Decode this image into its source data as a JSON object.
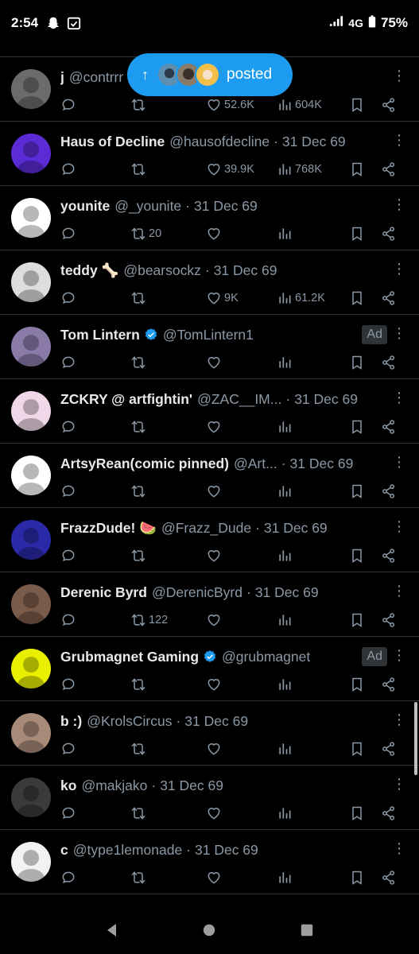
{
  "status_bar": {
    "time": "2:54",
    "network": "4G",
    "battery": "75%",
    "icons": [
      "snapchat-ghost-icon",
      "calendar-check-icon",
      "signal-icon",
      "battery-icon"
    ]
  },
  "posted_pill": {
    "label": "posted",
    "icon": "arrow-up-icon"
  },
  "tweets": [
    {
      "name": "j",
      "handle": "@contrrr",
      "date": "",
      "verified": false,
      "ad": "",
      "reply": "",
      "retweet": "",
      "like": "52.6K",
      "views": "604K",
      "avatar": "#6b6b6b"
    },
    {
      "name": "Haus of Decline",
      "handle": "@hausofdecline",
      "date": "31 Dec 69",
      "verified": false,
      "ad": "",
      "reply": "",
      "retweet": "",
      "like": "39.9K",
      "views": "768K",
      "avatar": "#5b2bd6"
    },
    {
      "name": "younite",
      "handle": "@_younite",
      "date": "31 Dec 69",
      "verified": false,
      "ad": "",
      "reply": "",
      "retweet": "20",
      "like": "",
      "views": "",
      "avatar": "#ffffff"
    },
    {
      "name": "teddy 🦴",
      "handle": "@bearsockz",
      "date": "31 Dec 69",
      "verified": false,
      "ad": "",
      "reply": "",
      "retweet": "",
      "like": "9K",
      "views": "61.2K",
      "avatar": "#dddddd"
    },
    {
      "name": "Tom Lintern",
      "handle": "@TomLintern1",
      "date": "",
      "verified": true,
      "ad": "Ad",
      "reply": "",
      "retweet": "",
      "like": "",
      "views": "",
      "avatar": "#8a7aa8"
    },
    {
      "name": "ZCKRY @ artfightin'",
      "handle": "@ZAC__IM...",
      "date": "31 Dec 69",
      "verified": false,
      "ad": "",
      "reply": "",
      "retweet": "",
      "like": "",
      "views": "",
      "avatar": "#f0d8e8"
    },
    {
      "name": "ArtsyRean(comic pinned)",
      "handle": "@Art...",
      "date": "31 Dec 69",
      "verified": false,
      "ad": "",
      "reply": "",
      "retweet": "",
      "like": "",
      "views": "",
      "avatar": "#ffffff"
    },
    {
      "name": "FrazzDude! 🍉",
      "handle": "@Frazz_Dude",
      "date": "31 Dec 69",
      "verified": false,
      "ad": "",
      "reply": "",
      "retweet": "",
      "like": "",
      "views": "",
      "avatar": "#2a2aa8"
    },
    {
      "name": "Derenic Byrd",
      "handle": "@DerenicByrd",
      "date": "31 Dec 69",
      "verified": false,
      "ad": "",
      "reply": "",
      "retweet": "122",
      "like": "",
      "views": "",
      "avatar": "#7a5a48"
    },
    {
      "name": "Grubmagnet Gaming",
      "handle": "@grubmagnet",
      "date": "",
      "verified": true,
      "ad": "Ad",
      "reply": "",
      "retweet": "",
      "like": "",
      "views": "",
      "avatar": "#e8f000"
    },
    {
      "name": "b :)",
      "handle": "@KrolsCircus",
      "date": "31 Dec 69",
      "verified": false,
      "ad": "",
      "reply": "",
      "retweet": "",
      "like": "",
      "views": "",
      "avatar": "#a88a78"
    },
    {
      "name": "ko",
      "handle": "@makjako",
      "date": "31 Dec 69",
      "verified": false,
      "ad": "",
      "reply": "",
      "retweet": "",
      "like": "",
      "views": "",
      "avatar": "#3a3a3a"
    },
    {
      "name": "c",
      "handle": "@type1lemonade",
      "date": "31 Dec 69",
      "verified": false,
      "ad": "",
      "reply": "",
      "retweet": "",
      "like": "",
      "views": "",
      "avatar": "#f2f2f2"
    }
  ],
  "nav_bar": {
    "icons": [
      "back-icon",
      "home-icon",
      "recents-icon"
    ]
  },
  "colors": {
    "background": "#000000",
    "accent": "#1d9bf0",
    "muted": "#8b98a5",
    "divider": "#2f3336"
  }
}
